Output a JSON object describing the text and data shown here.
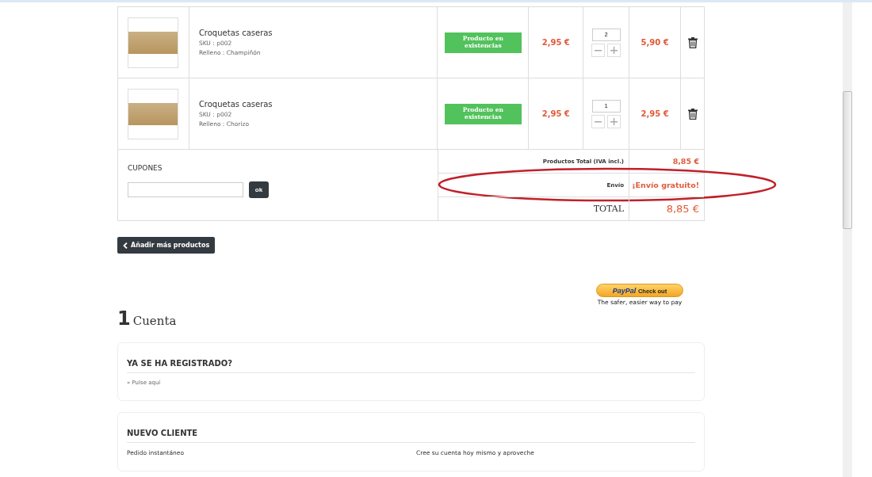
{
  "cart": {
    "items": [
      {
        "name": "Croquetas caseras",
        "sku": "SKU : p002",
        "option": "Relleno : Champiñón",
        "stock": "Producto en existencias",
        "price": "2,95 €",
        "quantity": "2",
        "total": "5,90 €"
      },
      {
        "name": "Croquetas caseras",
        "sku": "SKU : p002",
        "option": "Relleno : Chorizo",
        "stock": "Producto en existencias",
        "price": "2,95 €",
        "quantity": "1",
        "total": "2,95 €"
      }
    ],
    "coupons": {
      "label": "CUPONES",
      "button": "ok"
    },
    "summary": [
      {
        "kind": "subtotal",
        "label": "Productos Total (IVA incl.)",
        "value": "8,85 €",
        "highlighted": false
      },
      {
        "kind": "shipping",
        "label": "Envío",
        "value": "¡Envío gratuito!",
        "highlighted": true
      },
      {
        "kind": "total",
        "label": "TOTAL",
        "value": "8,85 €",
        "highlighted": false
      }
    ]
  },
  "add_more_button": "Añadir más productos",
  "paypal": {
    "brand": "PayPal",
    "action": "Check out",
    "tagline": "The safer, easier way to pay"
  },
  "account": {
    "step": "1",
    "title": "Cuenta",
    "registered": {
      "heading": "YA SE HA REGISTRADO?",
      "link": "» Pulse aquí"
    },
    "new_customer": {
      "heading": "NUEVO CLIENTE",
      "left": "Pedido instantáneo",
      "right": "Cree su cuenta hoy mismo y aproveche"
    }
  }
}
